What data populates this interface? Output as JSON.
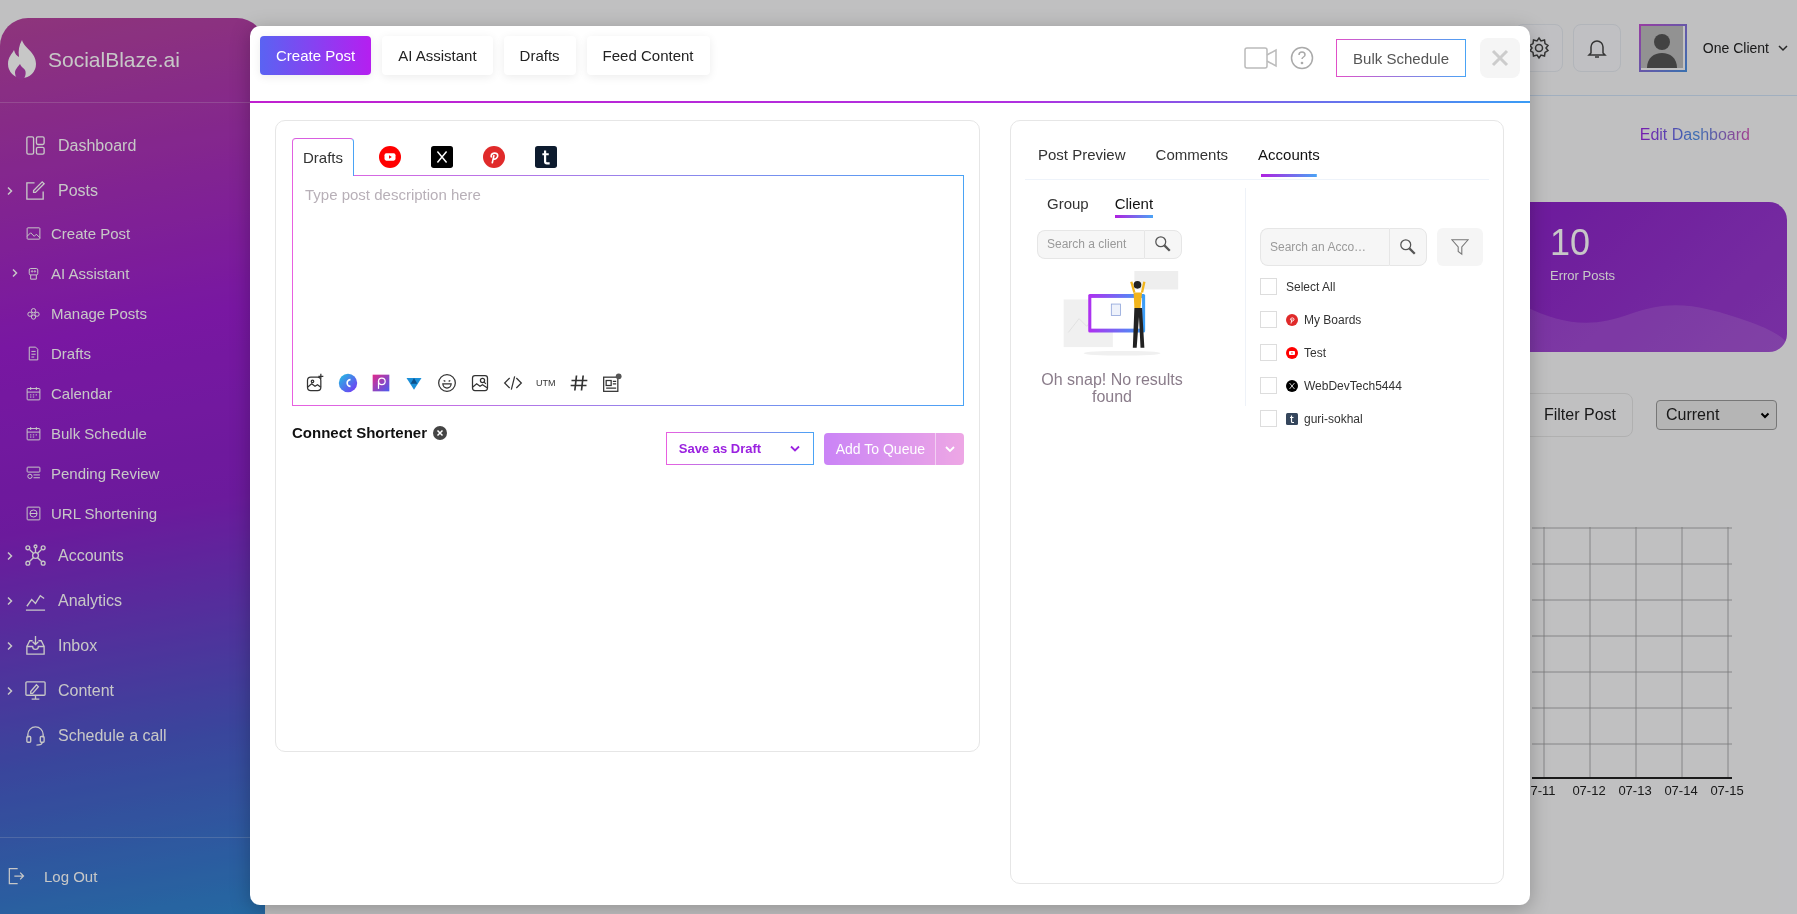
{
  "sidebar": {
    "brand": "SocialBlaze.ai",
    "items": [
      {
        "label": "Dashboard",
        "expandable": false
      },
      {
        "label": "Posts",
        "expandable": true,
        "children": [
          {
            "label": "Create Post",
            "expandable": false
          },
          {
            "label": "AI Assistant",
            "expandable": true
          },
          {
            "label": "Manage Posts",
            "expandable": false
          },
          {
            "label": "Drafts",
            "expandable": false
          },
          {
            "label": "Calendar",
            "expandable": false
          },
          {
            "label": "Bulk Schedule",
            "expandable": false
          },
          {
            "label": "Pending Review",
            "expandable": false
          },
          {
            "label": "URL Shortening",
            "expandable": false
          }
        ]
      },
      {
        "label": "Accounts",
        "expandable": true
      },
      {
        "label": "Analytics",
        "expandable": true
      },
      {
        "label": "Inbox",
        "expandable": true
      },
      {
        "label": "Content",
        "expandable": true
      },
      {
        "label": "Schedule a call",
        "expandable": false
      }
    ],
    "logout": "Log Out"
  },
  "header": {
    "client": "One Client"
  },
  "dashboard": {
    "edit_link": "Edit Dashboard",
    "stat": {
      "value": "10",
      "label": "Error Posts"
    },
    "filter_button": "Filter Post",
    "period_select": "Current",
    "chart_labels": [
      "7-11",
      "07-12",
      "07-13",
      "07-14",
      "07-15"
    ]
  },
  "modal": {
    "tabs": [
      {
        "label": "Create Post",
        "selected": true
      },
      {
        "label": "AI Assistant",
        "selected": false
      },
      {
        "label": "Drafts",
        "selected": false
      },
      {
        "label": "Feed Content",
        "selected": false
      }
    ],
    "bulk_schedule": "Bulk Schedule",
    "editor": {
      "tabs": [
        {
          "kind": "text",
          "label": "Drafts",
          "selected": true
        },
        {
          "kind": "youtube",
          "selected": false
        },
        {
          "kind": "x",
          "selected": false
        },
        {
          "kind": "pinterest",
          "selected": false
        },
        {
          "kind": "tumblr",
          "selected": false
        }
      ],
      "placeholder": "Type post description here",
      "toolbar": [
        {
          "kind": "image-add"
        },
        {
          "kind": "canva"
        },
        {
          "kind": "picsart"
        },
        {
          "kind": "vista"
        },
        {
          "kind": "emoji"
        },
        {
          "kind": "image-search"
        },
        {
          "kind": "code"
        },
        {
          "kind": "text",
          "label": "UTM"
        },
        {
          "kind": "hashtag"
        },
        {
          "kind": "media"
        }
      ],
      "shortener": "Connect Shortener",
      "save_draft": "Save as Draft",
      "add_queue": {
        "label": "Add To Queue",
        "disabled": true
      }
    },
    "preview": {
      "tabs": [
        {
          "label": "Post Preview",
          "selected": false
        },
        {
          "label": "Comments",
          "selected": false
        },
        {
          "label": "Accounts",
          "selected": true
        }
      ],
      "subtabs": [
        {
          "label": "Group",
          "selected": false
        },
        {
          "label": "Client",
          "selected": true
        }
      ],
      "client_search": {
        "placeholder": "Search a client"
      },
      "empty_message": "Oh snap! No results found",
      "account_search": {
        "placeholder": "Search an Acco…"
      },
      "select_all": {
        "label": "Select All",
        "checked": false
      },
      "accounts": [
        {
          "name": "My Boards",
          "kind": "pinterest",
          "checked": false
        },
        {
          "name": "Test",
          "kind": "youtube",
          "checked": false
        },
        {
          "name": "WebDevTech5444",
          "kind": "x",
          "checked": false
        },
        {
          "name": "guri-sokhal",
          "kind": "tumblr",
          "checked": false
        }
      ]
    }
  }
}
